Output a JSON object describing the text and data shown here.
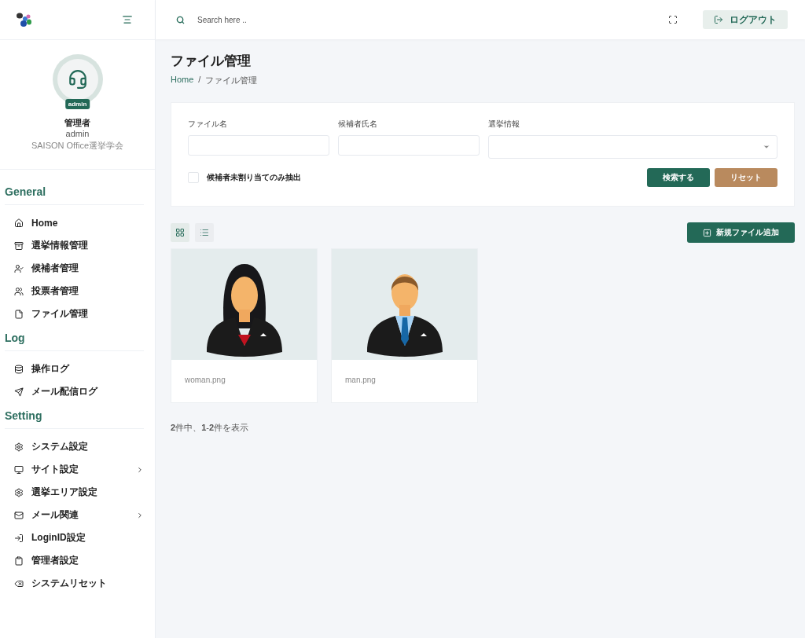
{
  "topbar": {
    "search": {
      "placeholder": "Search here .."
    },
    "logout": "ログアウト"
  },
  "profile": {
    "badge": "admin",
    "name": "管理者",
    "login": "admin",
    "organization": "SAISON Office選挙学会"
  },
  "sidebar": {
    "sections": [
      {
        "title": "General",
        "items": [
          {
            "label": "Home",
            "submenu": false
          },
          {
            "label": "選挙情報管理",
            "submenu": false
          },
          {
            "label": "候補者管理",
            "submenu": false
          },
          {
            "label": "投票者管理",
            "submenu": false
          },
          {
            "label": "ファイル管理",
            "submenu": false
          }
        ]
      },
      {
        "title": "Log",
        "items": [
          {
            "label": "操作ログ",
            "submenu": false
          },
          {
            "label": "メール配信ログ",
            "submenu": false
          }
        ]
      },
      {
        "title": "Setting",
        "items": [
          {
            "label": "システム設定",
            "submenu": false
          },
          {
            "label": "サイト設定",
            "submenu": true
          },
          {
            "label": "選挙エリア設定",
            "submenu": false
          },
          {
            "label": "メール関連",
            "submenu": true
          },
          {
            "label": "LoginID設定",
            "submenu": false
          },
          {
            "label": "管理者設定",
            "submenu": false
          },
          {
            "label": "システムリセット",
            "submenu": false
          }
        ]
      }
    ]
  },
  "page": {
    "title": "ファイル管理",
    "breadcrumb_separator": "/",
    "breadcrumb": [
      {
        "label": "Home",
        "link": true
      },
      {
        "label": "ファイル管理",
        "link": false
      }
    ]
  },
  "filters": {
    "fields": [
      {
        "label": "ファイル名",
        "kind": "text"
      },
      {
        "label": "候補者氏名",
        "kind": "text"
      },
      {
        "label": "選挙情報",
        "kind": "select"
      }
    ],
    "checkbox": {
      "label": "候補者未割り当てのみ抽出",
      "checked": false
    },
    "buttons": [
      {
        "label": "検索する",
        "kind": "primary"
      },
      {
        "label": "リセット",
        "kind": "reset"
      }
    ]
  },
  "views": [
    {
      "kind": "grid",
      "selected": true
    },
    {
      "kind": "list",
      "selected": false
    }
  ],
  "add_button": "新規ファイル追加",
  "files": [
    {
      "name": "woman.png",
      "kind": "woman"
    },
    {
      "name": "man.png",
      "kind": "man"
    }
  ],
  "summary": "**2**件中、**1**-**2**件を表示"
}
